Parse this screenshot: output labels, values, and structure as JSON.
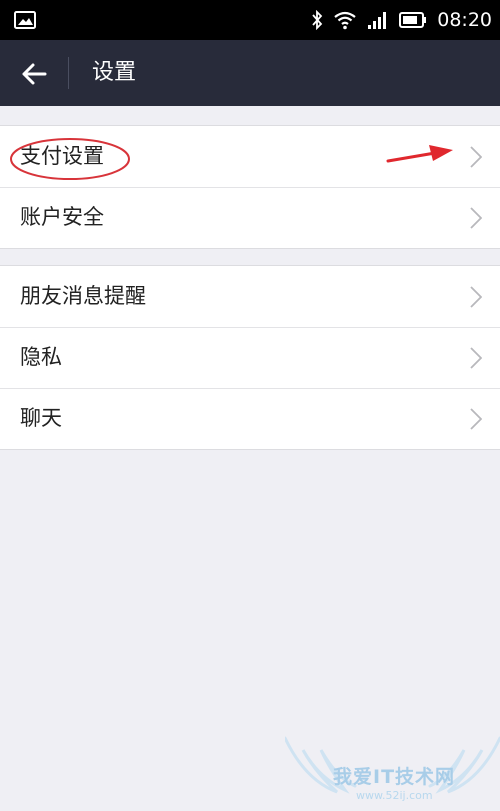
{
  "status_bar": {
    "time": "08:20",
    "icons": [
      "image-icon",
      "bluetooth-icon",
      "wifi-icon",
      "signal-icon",
      "battery-icon"
    ]
  },
  "header": {
    "title": "设置",
    "back_icon": "back-arrow-icon"
  },
  "settings": {
    "group1": [
      {
        "label": "支付设置"
      },
      {
        "label": "账户安全"
      }
    ],
    "group2": [
      {
        "label": "朋友消息提醒"
      },
      {
        "label": "隐私"
      },
      {
        "label": "聊天"
      }
    ]
  },
  "annotations": {
    "circle_color": "#d8343a",
    "arrow_color": "#e0282e"
  },
  "watermark": {
    "text": "我爱IT技术网",
    "url": "www.52ij.com"
  },
  "colors": {
    "header_bg": "#282b3a",
    "page_bg": "#efeff4",
    "chevron": "#b8b8bc"
  }
}
